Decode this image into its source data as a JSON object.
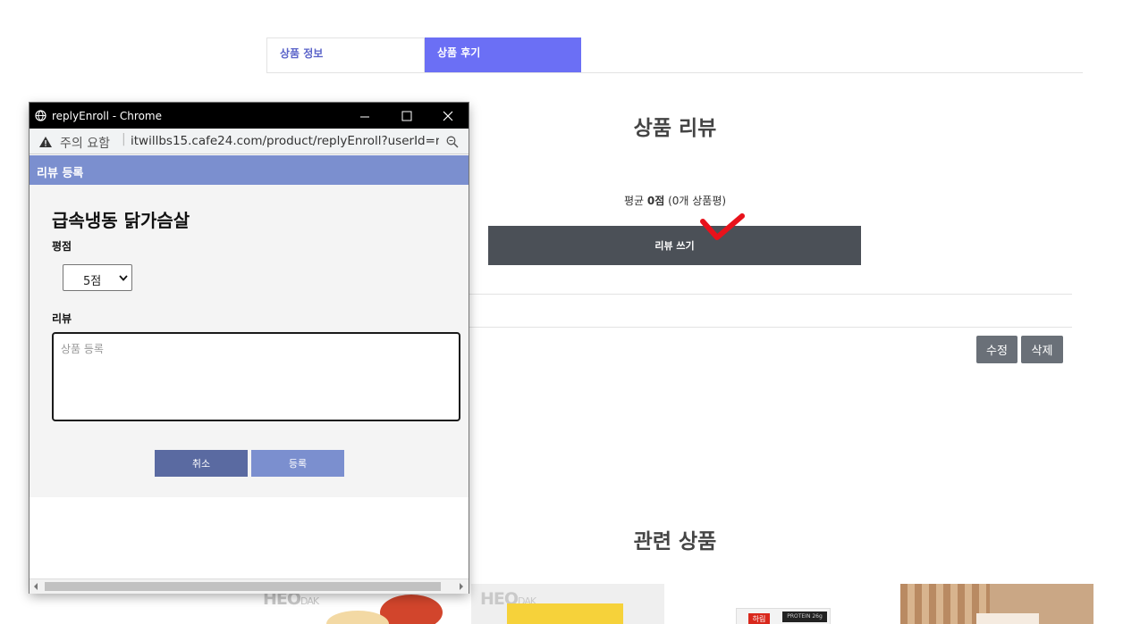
{
  "tabs": {
    "info": "상품 정보",
    "review": "상품 후기"
  },
  "review_section": {
    "title": "상품 리뷰",
    "avg_prefix": "평균 ",
    "avg_score": "0점",
    "avg_suffix": " (0개 상품평)",
    "write_button": "리뷰 쓰기",
    "edit_button": "수정",
    "delete_button": "삭제"
  },
  "related": {
    "title": "관련 상품",
    "brand_1": "HEO",
    "brand_1_sub": "DAK",
    "brand_2": "HEO",
    "brand_2_sub": "DAK",
    "box_label": "하림",
    "box_protein": "PROTEIN 26g"
  },
  "popup": {
    "window_title": "replyEnroll - Chrome",
    "security_label": "주의 요함",
    "url": "itwillbs15.cafe24.com/product/replyEnroll?userId=ra...",
    "header": "리뷰 등록",
    "product_name": "급속냉동 닭가슴살",
    "rating_label": "평점",
    "rating_value": "5점",
    "review_label": "리뷰",
    "review_placeholder": "상품 등록",
    "cancel_button": "취소",
    "submit_button": "등록"
  },
  "colors": {
    "accent": "#6b6ff5",
    "popup_header": "#7b8fcf",
    "dark_button": "#4b5057",
    "annotation_check": "#e8121b"
  }
}
